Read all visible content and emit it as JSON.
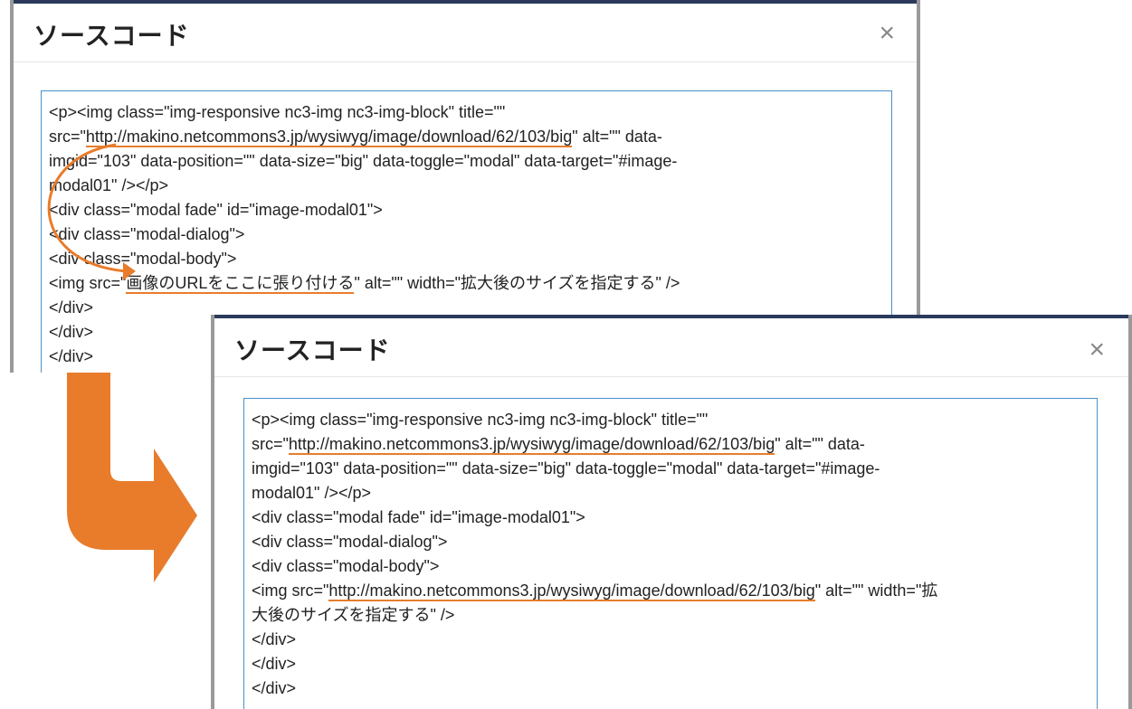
{
  "dialog_before": {
    "title": "ソースコード",
    "close_label": "×",
    "lines": [
      {
        "parts": [
          "<p><img class=\"img-responsive nc3-img nc3-img-block\" title=\"\""
        ]
      },
      {
        "pre": "src=\"",
        "url": "http://makino.netcommons3.jp/wysiwyg/image/download/62/103/big",
        "post": "\" alt=\"\" data-"
      },
      {
        "parts": [
          "imgid=\"103\" data-position=\"\" data-size=\"big\" data-toggle=\"modal\" data-target=\"#image-"
        ]
      },
      {
        "parts": [
          "modal01\" /></p>"
        ]
      },
      {
        "parts": [
          "<div class=\"modal fade\" id=\"image-modal01\">"
        ]
      },
      {
        "parts": [
          "<div class=\"modal-dialog\">"
        ]
      },
      {
        "parts": [
          "<div class=\"modal-body\">"
        ]
      },
      {
        "pre": "<img src=\"",
        "url": "画像のURLをここに張り付ける",
        "post": "\" alt=\"\" width=\"拡大後のサイズを指定する\" />"
      },
      {
        "parts": [
          "</div>"
        ]
      },
      {
        "parts": [
          "</div>"
        ]
      },
      {
        "parts": [
          "</div>"
        ]
      }
    ]
  },
  "dialog_after": {
    "title": "ソースコード",
    "close_label": "×",
    "lines": [
      {
        "parts": [
          "<p><img class=\"img-responsive nc3-img nc3-img-block\" title=\"\""
        ]
      },
      {
        "pre": "src=\"",
        "url": "http://makino.netcommons3.jp/wysiwyg/image/download/62/103/big",
        "post": "\" alt=\"\" data-"
      },
      {
        "parts": [
          "imgid=\"103\" data-position=\"\" data-size=\"big\" data-toggle=\"modal\" data-target=\"#image-"
        ]
      },
      {
        "parts": [
          "modal01\" /></p>"
        ]
      },
      {
        "parts": [
          "<div class=\"modal fade\" id=\"image-modal01\">"
        ]
      },
      {
        "parts": [
          "<div class=\"modal-dialog\">"
        ]
      },
      {
        "parts": [
          "<div class=\"modal-body\">"
        ]
      },
      {
        "pre": "<img src=\"",
        "url": "http://makino.netcommons3.jp/wysiwyg/image/download/62/103/big",
        "post": "\" alt=\"\" width=\"拡"
      },
      {
        "parts": [
          "大後のサイズを指定する\" />"
        ]
      },
      {
        "parts": [
          "</div>"
        ]
      },
      {
        "parts": [
          "</div>"
        ]
      },
      {
        "parts": [
          "</div>"
        ]
      }
    ]
  },
  "colors": {
    "accent": "#e87c2b",
    "textarea_border": "#4a90c8",
    "header_bar": "#2b3a5c"
  }
}
